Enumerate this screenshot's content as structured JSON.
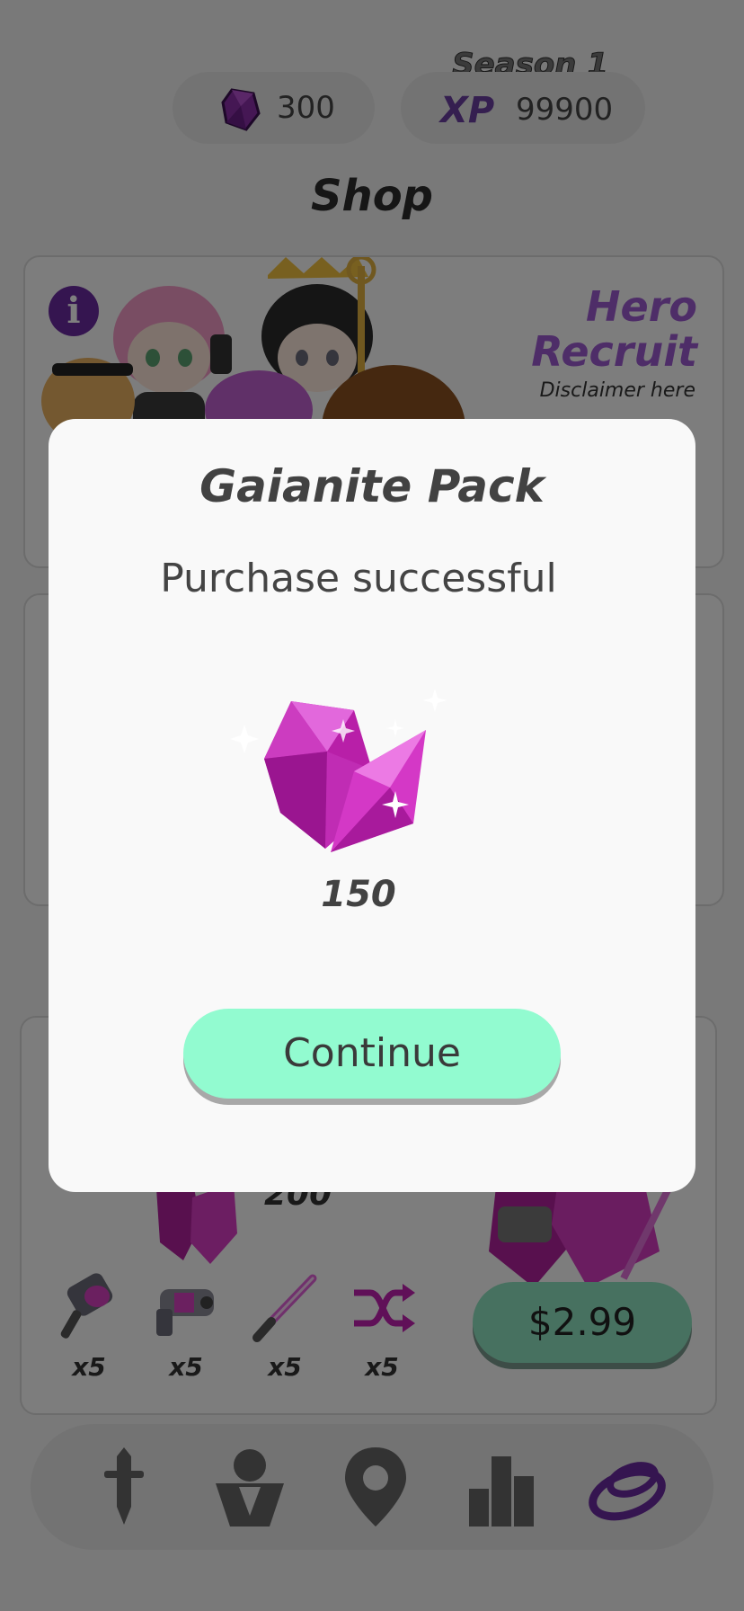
{
  "header": {
    "gems_value": "300",
    "xp_label": "XP",
    "xp_value": "99900",
    "season_label": "Season 1"
  },
  "shop": {
    "title": "Shop",
    "hero_card": {
      "info_icon": "i",
      "title_line1": "Hero",
      "title_line2": "Recruit",
      "disclaimer": "Disclaimer here"
    },
    "bundle_card": {
      "crystal_count": "200",
      "items": [
        {
          "icon": "hammer-icon",
          "qty": "x5"
        },
        {
          "icon": "blaster-icon",
          "qty": "x5"
        },
        {
          "icon": "saber-icon",
          "qty": "x5"
        },
        {
          "icon": "shuffle-icon",
          "qty": "x5"
        }
      ],
      "price": "$2.99"
    }
  },
  "bottom_nav": [
    {
      "icon": "sword-icon"
    },
    {
      "icon": "heroes-icon"
    },
    {
      "icon": "map-pin-icon"
    },
    {
      "icon": "leaderboard-icon"
    },
    {
      "icon": "shop-icon",
      "active": true
    }
  ],
  "modal": {
    "title": "Gaianite Pack",
    "message": "Purchase successful",
    "amount": "150",
    "continue_label": "Continue"
  },
  "colors": {
    "accent_purple": "#6a2aa0",
    "continue_green": "#92fbd0",
    "price_green": "#8fe3c0",
    "gem_magenta": "#c623b8"
  }
}
